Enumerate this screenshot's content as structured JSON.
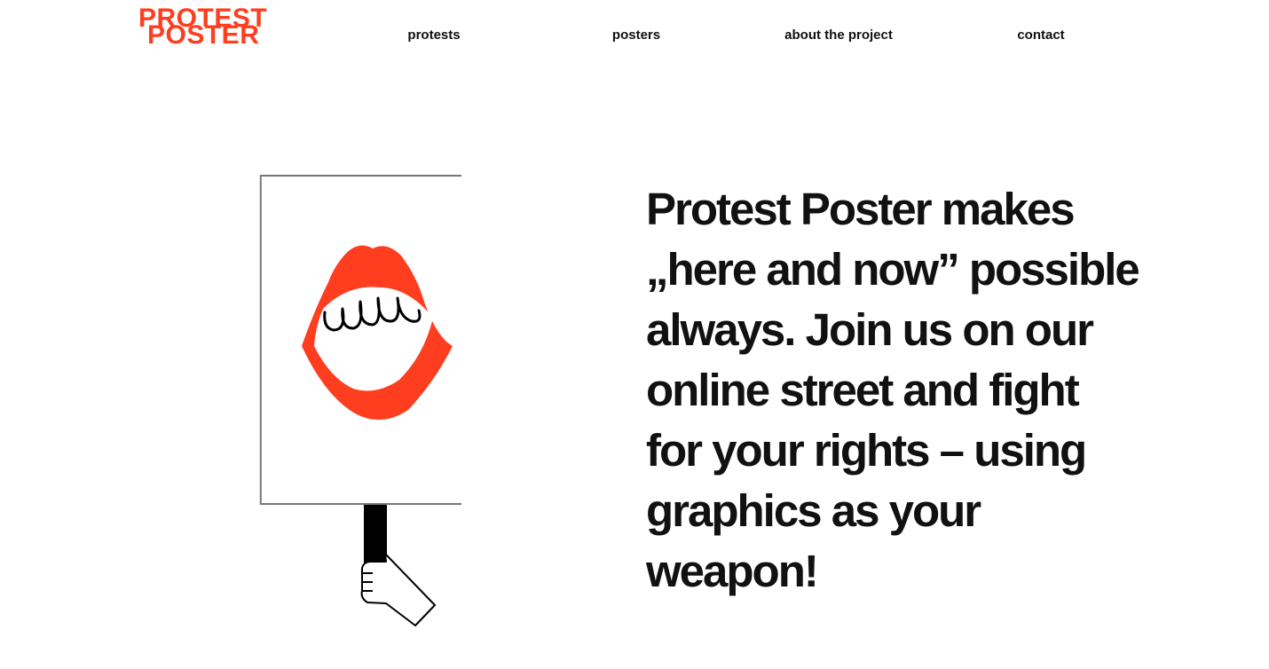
{
  "logo": {
    "line1": "PROTEST",
    "line2": "POSTER",
    "color": "#ff3d1f"
  },
  "nav": {
    "items": [
      {
        "label": "protests"
      },
      {
        "label": "posters"
      },
      {
        "label": "about the project"
      },
      {
        "label": "contact"
      }
    ]
  },
  "hero": {
    "headline": "Protest Poster makes „here and now” possible always.  Join us on our online street and fight for your rights – using graphics as your weapon!",
    "illustration": "hand-holding-protest-sign-with-open-mouth",
    "accent_color": "#ff3d1f"
  }
}
